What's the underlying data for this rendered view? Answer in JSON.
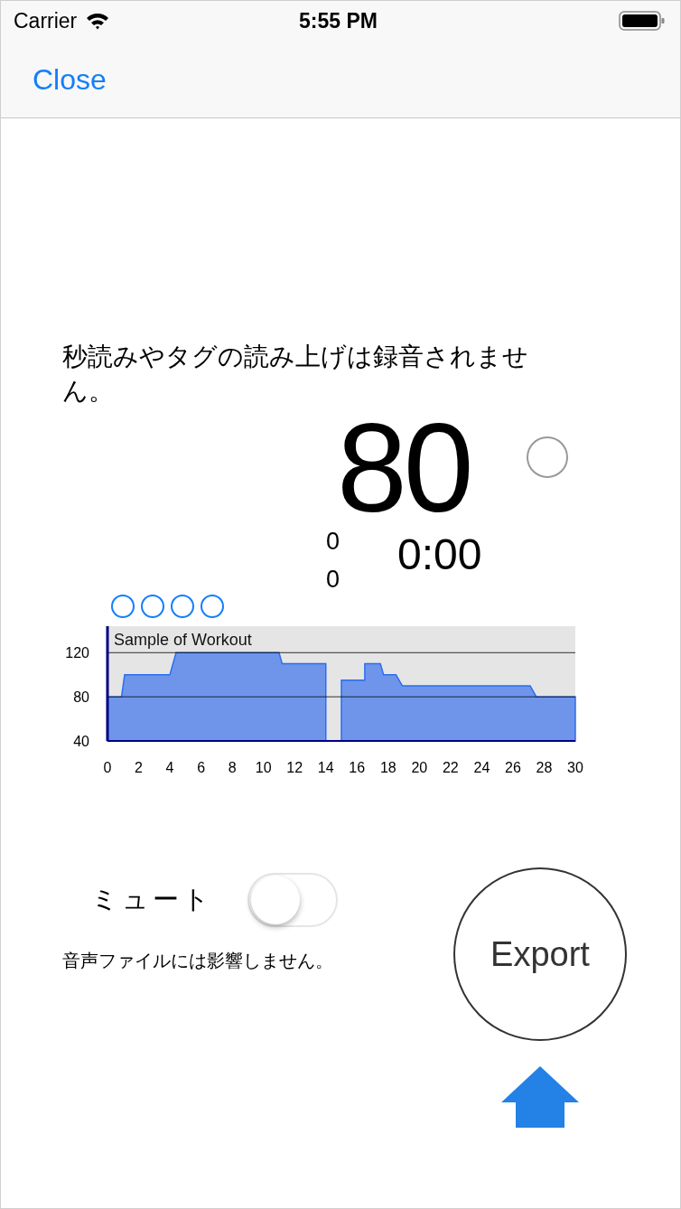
{
  "status_bar": {
    "carrier": "Carrier",
    "time": "5:55 PM"
  },
  "nav": {
    "close": "Close"
  },
  "notice": "秒読みやタグの読み上げは録音されません。",
  "heart_rate": "80",
  "counters": [
    "0",
    "0"
  ],
  "elapsed": "0:00",
  "chart": {
    "chart_data": {
      "type": "area",
      "title": "Sample of Workout",
      "xlim": [
        0,
        30
      ],
      "ylim": [
        40,
        144
      ],
      "xticks": [
        0,
        2,
        4,
        6,
        8,
        10,
        12,
        14,
        16,
        18,
        20,
        22,
        24,
        26,
        28,
        30
      ],
      "yticks": [
        40,
        80,
        120
      ],
      "x": [
        0,
        0.9,
        1.1,
        4,
        4.4,
        11,
        11.2,
        14,
        14,
        15,
        15,
        16.5,
        16.5,
        17.5,
        17.7,
        18.5,
        18.9,
        27.1,
        27.5,
        30
      ],
      "series": [
        {
          "color": "#6f95eb",
          "values": [
            80,
            80,
            100,
            100,
            120,
            120,
            110,
            110,
            40,
            40,
            95,
            95,
            110,
            110,
            100,
            100,
            90,
            90,
            80,
            80
          ]
        }
      ]
    }
  },
  "mute": {
    "label": "ミュート",
    "on": false,
    "note": "音声ファイルには影響しません。"
  },
  "export": {
    "label": "Export"
  }
}
